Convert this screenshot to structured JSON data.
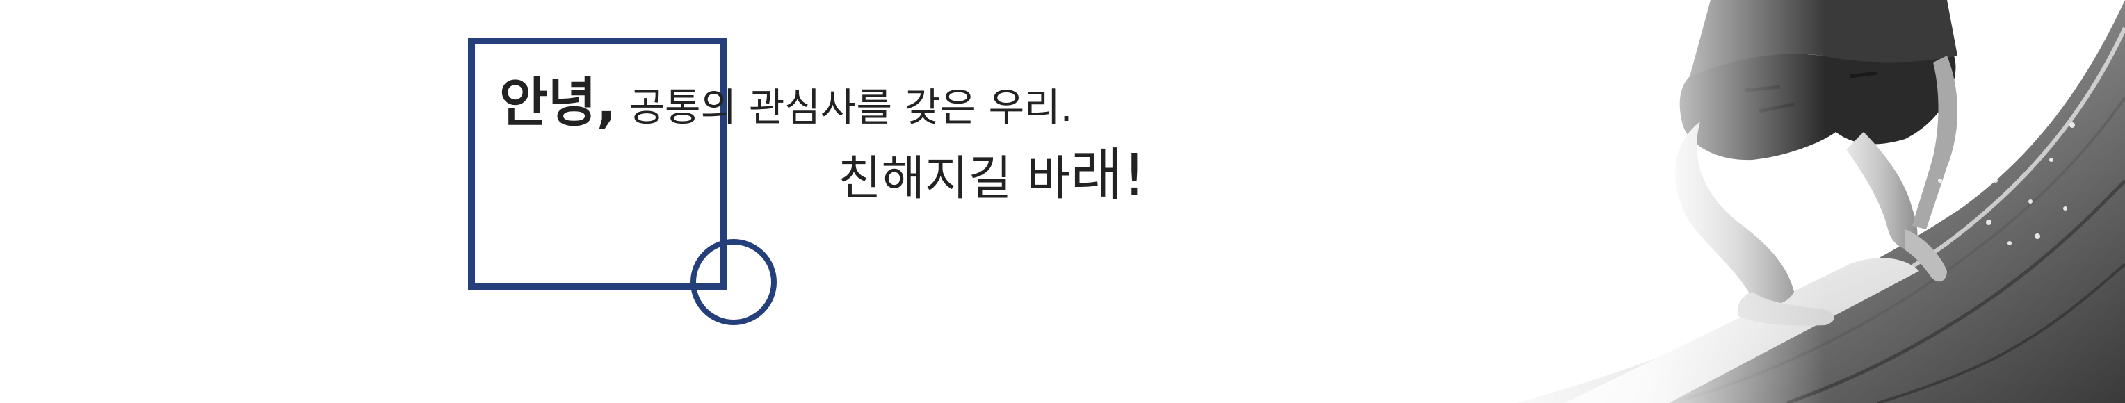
{
  "headline": {
    "line1_part_a": "안녕,",
    "line1_part_b": " 공통의 관심사를 갖은 우리.",
    "line2_part_a": "친해지길 바",
    "line2_part_b": "래!"
  },
  "colors": {
    "accent": "#253f7a",
    "text": "#222222",
    "background": "#ffffff"
  },
  "decor": {
    "shapes": [
      "outline-square",
      "outline-circle"
    ],
    "photo": "surfer-on-wave-grayscale"
  }
}
